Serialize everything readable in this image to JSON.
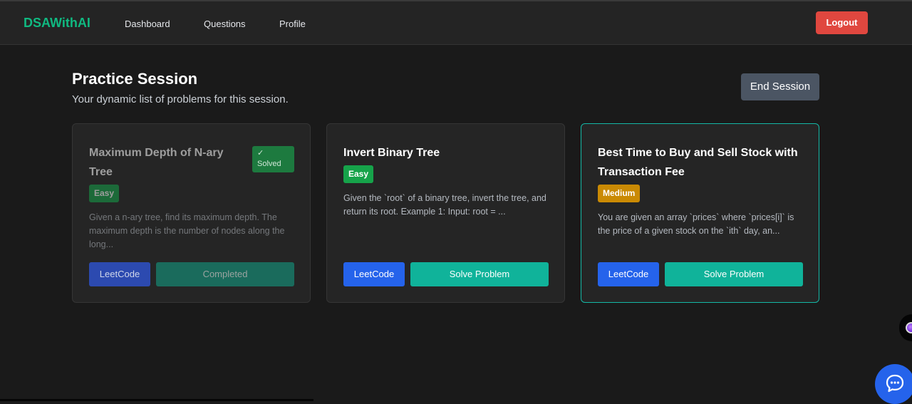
{
  "nav": {
    "brand": "DSAWithAI",
    "links": [
      "Dashboard",
      "Questions",
      "Profile"
    ],
    "logout_label": "Logout"
  },
  "header": {
    "title": "Practice Session",
    "subtitle": "Your dynamic list of problems for this session.",
    "end_session_label": "End Session"
  },
  "cards": [
    {
      "title": "Maximum Depth of N-ary Tree",
      "difficulty": "Easy",
      "description": "Given a n-ary tree, find its maximum depth. The maximum depth is the number of nodes along the long...",
      "solved_check": "✓",
      "solved_label": "Solved",
      "leetcode_label": "LeetCode",
      "action_label": "Completed"
    },
    {
      "title": "Invert Binary Tree",
      "difficulty": "Easy",
      "description": "Given the `root` of a binary tree, invert the tree, and return its root. Example 1: Input: root = ...",
      "leetcode_label": "LeetCode",
      "action_label": "Solve Problem"
    },
    {
      "title": "Best Time to Buy and Sell Stock with Transaction Fee",
      "difficulty": "Medium",
      "description": "You are given an array `prices` where `prices[i]` is the price of a given stock on the `ith` day, an...",
      "leetcode_label": "LeetCode",
      "action_label": "Solve Problem"
    }
  ],
  "colors": {
    "brand": "#10b981",
    "logout": "#e0473f",
    "leetcode": "#2563eb",
    "solve": "#10b39a",
    "easy": "#16a34a",
    "medium": "#ca8a04"
  },
  "icons": {
    "chat": "chat-bubble-icon",
    "side_widget": "extension-icon"
  }
}
